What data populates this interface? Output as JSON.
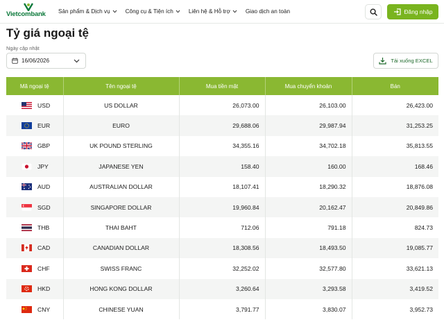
{
  "header": {
    "brand": "Vietcombank",
    "nav": [
      {
        "label": "Sản phẩm & Dịch vụ",
        "dropdown": true
      },
      {
        "label": "Công cụ & Tiện ích",
        "dropdown": true
      },
      {
        "label": "Liên hệ & Hỗ trợ",
        "dropdown": true
      },
      {
        "label": "Giao dịch an toàn",
        "dropdown": false
      }
    ],
    "search_icon": "search-icon",
    "login_label": "Đăng nhập",
    "login_icon": "login-icon"
  },
  "page": {
    "title": "Tỷ giá ngoại tệ",
    "date_label": "Ngày cập nhật",
    "date_value": "16/06/2026",
    "excel_label": "Tải xuống EXCEL"
  },
  "table": {
    "headers": [
      "Mã ngoại tệ",
      "Tên ngoại tệ",
      "Mua tiền mặt",
      "Mua chuyển khoản",
      "Bán"
    ],
    "rows": [
      {
        "code": "USD",
        "name": "US DOLLAR",
        "cash": "26,073.00",
        "transfer": "26,103.00",
        "sell": "26,423.00",
        "flag": "us-flag"
      },
      {
        "code": "EUR",
        "name": "EURO",
        "cash": "29,688.06",
        "transfer": "29,987.94",
        "sell": "31,253.25",
        "flag": "eu-flag"
      },
      {
        "code": "GBP",
        "name": "UK POUND STERLING",
        "cash": "34,355.16",
        "transfer": "34,702.18",
        "sell": "35,813.55",
        "flag": "gb-flag"
      },
      {
        "code": "JPY",
        "name": "JAPANESE YEN",
        "cash": "158.40",
        "transfer": "160.00",
        "sell": "168.46",
        "flag": "jp-flag"
      },
      {
        "code": "AUD",
        "name": "AUSTRALIAN DOLLAR",
        "cash": "18,107.41",
        "transfer": "18,290.32",
        "sell": "18,876.08",
        "flag": "au-flag"
      },
      {
        "code": "SGD",
        "name": "SINGAPORE DOLLAR",
        "cash": "19,960.84",
        "transfer": "20,162.47",
        "sell": "20,849.86",
        "flag": "sg-flag"
      },
      {
        "code": "THB",
        "name": "THAI BAHT",
        "cash": "712.06",
        "transfer": "791.18",
        "sell": "824.73",
        "flag": "th-flag"
      },
      {
        "code": "CAD",
        "name": "CANADIAN DOLLAR",
        "cash": "18,308.56",
        "transfer": "18,493.50",
        "sell": "19,085.77",
        "flag": "ca-flag"
      },
      {
        "code": "CHF",
        "name": "SWISS FRANC",
        "cash": "32,252.02",
        "transfer": "32,577.80",
        "sell": "33,621.13",
        "flag": "ch-flag"
      },
      {
        "code": "HKD",
        "name": "HONG KONG DOLLAR",
        "cash": "3,260.64",
        "transfer": "3,293.58",
        "sell": "3,419.52",
        "flag": "hk-flag"
      },
      {
        "code": "CNY",
        "name": "CHINESE YUAN",
        "cash": "3,791.77",
        "transfer": "3,830.07",
        "sell": "3,952.73",
        "flag": "cn-flag"
      }
    ]
  },
  "colors": {
    "brand_green": "#0d7a3c",
    "accent_green": "#79b41f",
    "table_header": "#8ab832"
  }
}
